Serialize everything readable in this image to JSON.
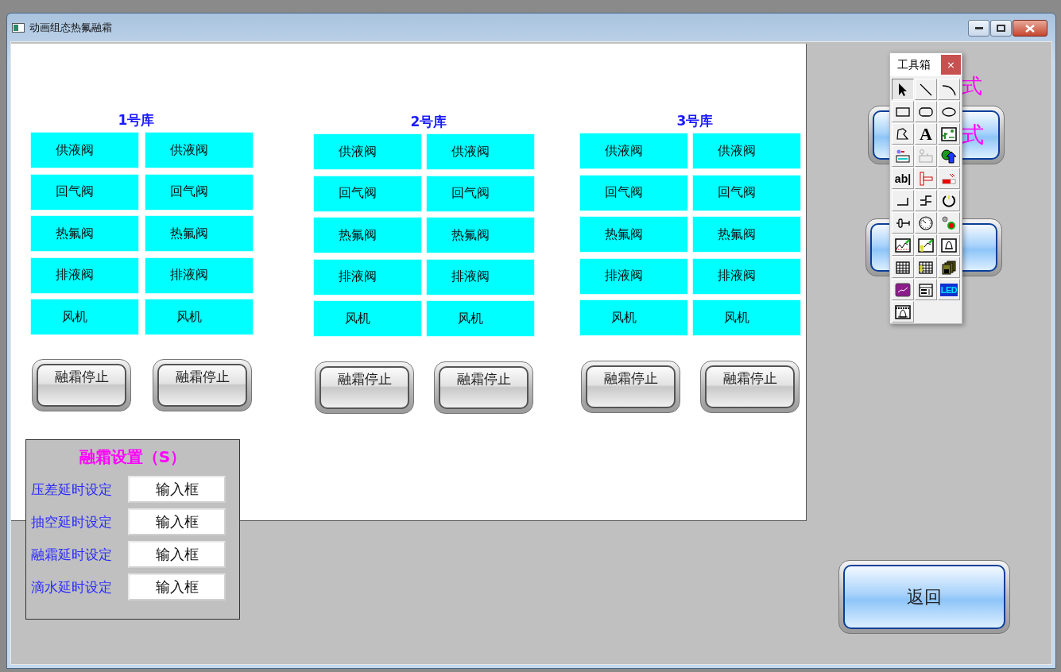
{
  "window": {
    "title": "动画组态热氟融霜"
  },
  "storages": [
    {
      "title": "1号库",
      "cells": [
        [
          "供液阀",
          "供液阀"
        ],
        [
          "回气阀",
          "回气阀"
        ],
        [
          "热氟阀",
          "热氟阀"
        ],
        [
          "排液阀",
          "排液阀"
        ],
        [
          "风机",
          "风机"
        ]
      ],
      "buttons": [
        "融霜停止",
        "融霜停止"
      ]
    },
    {
      "title": "2号库",
      "cells": [
        [
          "供液阀",
          "供液阀"
        ],
        [
          "回气阀",
          "回气阀"
        ],
        [
          "热氟阀",
          "热氟阀"
        ],
        [
          "排液阀",
          "排液阀"
        ],
        [
          "风机",
          "风机"
        ]
      ],
      "buttons": [
        "融霜停止",
        "融霜停止"
      ]
    },
    {
      "title": "3号库",
      "cells": [
        [
          "供液阀",
          "供液阀"
        ],
        [
          "回气阀",
          "回气阀"
        ],
        [
          "热氟阀",
          "热氟阀"
        ],
        [
          "排液阀",
          "排液阀"
        ],
        [
          "风机",
          "风机"
        ]
      ],
      "buttons": [
        "融霜停止",
        "融霜停止"
      ]
    }
  ],
  "defrost_settings": {
    "title": "融霜设置（S）",
    "fields": [
      {
        "label": "压差延时设定",
        "value": "输入框"
      },
      {
        "label": "抽空延时设定",
        "value": "输入框"
      },
      {
        "label": "融霜延时设定",
        "value": "输入框"
      },
      {
        "label": "滴水延时设定",
        "value": "输入框"
      }
    ]
  },
  "covered_heading": "式",
  "covered_button": "式",
  "back_button": "返回",
  "toolbox": {
    "title": "工具箱",
    "close": "×",
    "tools": [
      {
        "kind": "pointer",
        "selected": true
      },
      {
        "kind": "line",
        "selected": false
      },
      {
        "kind": "arc",
        "selected": false
      },
      {
        "kind": "rectangle",
        "selected": false
      },
      {
        "kind": "rounded-rectangle",
        "selected": false
      },
      {
        "kind": "ellipse",
        "selected": false
      },
      {
        "kind": "polygon",
        "selected": false
      },
      {
        "kind": "glyph",
        "glyph": "A",
        "selected": false
      },
      {
        "kind": "bitmap",
        "selected": false
      },
      {
        "kind": "device",
        "selected": false
      },
      {
        "kind": "device-disabled",
        "selected": false
      },
      {
        "kind": "shape-arrow",
        "selected": false
      },
      {
        "kind": "glyph",
        "glyph": "ab|",
        "selected": false
      },
      {
        "kind": "slider",
        "selected": false
      },
      {
        "kind": "bar",
        "selected": false
      },
      {
        "kind": "corner",
        "selected": false
      },
      {
        "kind": "step",
        "selected": false
      },
      {
        "kind": "dial",
        "selected": false
      },
      {
        "kind": "key",
        "selected": false
      },
      {
        "kind": "gauge",
        "selected": false
      },
      {
        "kind": "lamp",
        "selected": false
      },
      {
        "kind": "trend",
        "selected": false
      },
      {
        "kind": "trend-data",
        "selected": false
      },
      {
        "kind": "bell",
        "selected": false
      },
      {
        "kind": "grid",
        "selected": false
      },
      {
        "kind": "grid-data",
        "selected": false
      },
      {
        "kind": "disk",
        "selected": false
      },
      {
        "kind": "chart",
        "selected": false
      },
      {
        "kind": "panel",
        "selected": false
      },
      {
        "kind": "led",
        "glyph": "LED",
        "selected": false
      },
      {
        "kind": "bell-frame",
        "selected": false
      }
    ]
  }
}
